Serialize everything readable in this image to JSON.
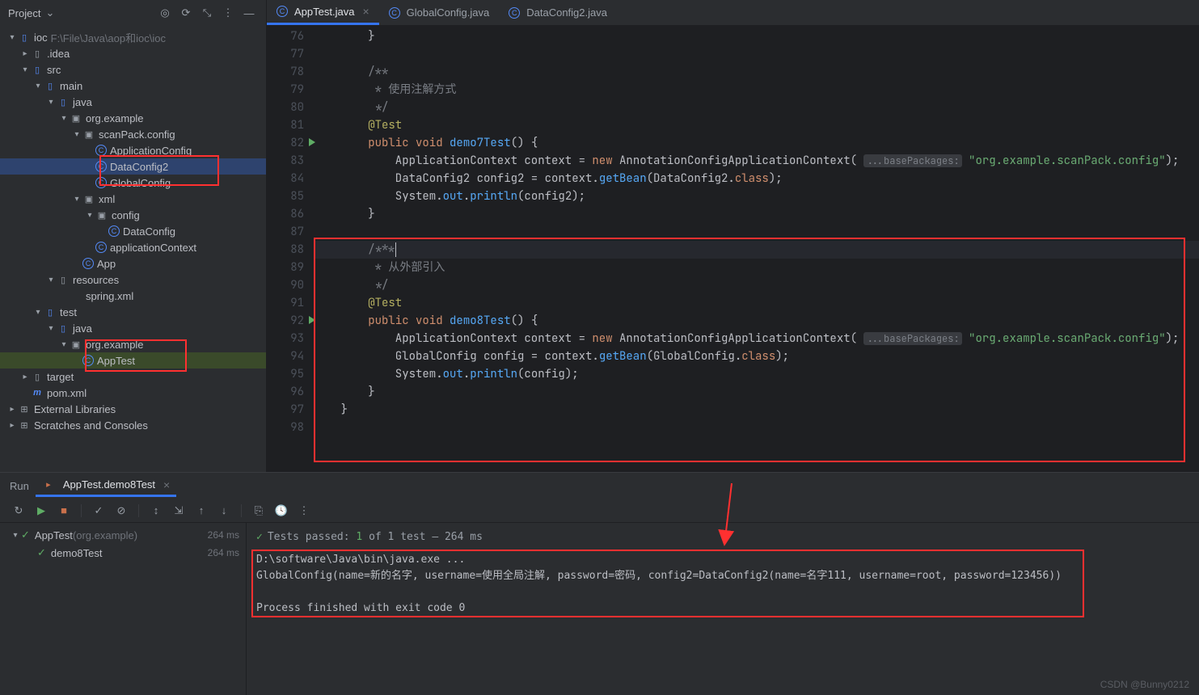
{
  "sidebar": {
    "title": "Project",
    "root": "ioc",
    "rootPath": "F:\\File\\Java\\aop和ioc\\ioc",
    "nodes": {
      "idea": ".idea",
      "src": "src",
      "main": "main",
      "java": "java",
      "pkg": "org.example",
      "scanpack": "scanPack.config",
      "appconfig": "ApplicationConfig",
      "dataconfig2": "DataConfig2",
      "globalconfig": "GlobalConfig",
      "xml": "xml",
      "config": "config",
      "dataconfig": "DataConfig",
      "appcontext": "applicationContext",
      "app": "App",
      "resources": "resources",
      "springxml": "spring.xml",
      "test": "test",
      "testjava": "java",
      "testpkg": "org.example",
      "apptest": "AppTest",
      "target": "target",
      "pom": "pom.xml",
      "extlib": "External Libraries",
      "scratches": "Scratches and Consoles"
    }
  },
  "tabs": [
    {
      "label": "AppTest.java",
      "active": true
    },
    {
      "label": "GlobalConfig.java",
      "active": false
    },
    {
      "label": "DataConfig2.java",
      "active": false
    }
  ],
  "code": {
    "startLine": 76,
    "lines": [
      {
        "n": 76,
        "html": "        }"
      },
      {
        "n": 77,
        "html": ""
      },
      {
        "n": 78,
        "html": "        <span class='cmt'>/**</span>"
      },
      {
        "n": 79,
        "html": "        <span class='cmt'> * 使用注解方式</span>"
      },
      {
        "n": 80,
        "html": "        <span class='cmt'> */</span>"
      },
      {
        "n": 81,
        "html": "        <span class='ann'>@Test</span>"
      },
      {
        "n": 82,
        "html": "        <span class='kw'>public void</span> <span class='fn'>demo7Test</span>() {",
        "run": true
      },
      {
        "n": 83,
        "html": "            ApplicationContext context = <span class='kw'>new</span> <span class='cls'>AnnotationConfigApplicationContext</span>( <span class='hint'>...basePackages:</span> <span class='str'>\"org.example.scanPack.config\"</span>);"
      },
      {
        "n": 84,
        "html": "            DataConfig2 config2 = context.<span class='fn'>getBean</span>(DataConfig2.<span class='kw'>class</span>);"
      },
      {
        "n": 85,
        "html": "            System.<span class='fn'>out</span>.<span class='fn'>println</span>(config2);"
      },
      {
        "n": 86,
        "html": "        }"
      },
      {
        "n": 87,
        "html": ""
      },
      {
        "n": 88,
        "html": "        <span class='cmt'>/***</span><span class='caret'></span>",
        "cur": true
      },
      {
        "n": 89,
        "html": "        <span class='cmt'> * 从外部引入</span>"
      },
      {
        "n": 90,
        "html": "        <span class='cmt'> */</span>"
      },
      {
        "n": 91,
        "html": "        <span class='ann'>@Test</span>"
      },
      {
        "n": 92,
        "html": "        <span class='kw'>public void</span> <span class='fn'>demo8Test</span>() {",
        "run": true
      },
      {
        "n": 93,
        "html": "            ApplicationContext context = <span class='kw'>new</span> <span class='cls'>AnnotationConfigApplicationContext</span>( <span class='hint'>...basePackages:</span> <span class='str'>\"org.example.scanPack.config\"</span>);"
      },
      {
        "n": 94,
        "html": "            GlobalConfig config = context.<span class='fn'>getBean</span>(GlobalConfig.<span class='kw'>class</span>);"
      },
      {
        "n": 95,
        "html": "            System.<span class='fn'>out</span>.<span class='fn'>println</span>(config);"
      },
      {
        "n": 96,
        "html": "        }"
      },
      {
        "n": 97,
        "html": "    }"
      },
      {
        "n": 98,
        "html": ""
      }
    ]
  },
  "run": {
    "label": "Run",
    "tab": "AppTest.demo8Test",
    "testsPrefix": "Tests passed:",
    "testsCount": "1",
    "testsSuffix": "of 1 test – 264 ms",
    "rows": [
      {
        "name": "AppTest",
        "pkg": "(org.example)",
        "time": "264 ms"
      },
      {
        "name": "demo8Test",
        "pkg": "",
        "time": "264 ms"
      }
    ],
    "console": [
      "D:\\software\\Java\\bin\\java.exe ...",
      "GlobalConfig(name=新的名字, username=使用全局注解, password=密码, config2=DataConfig2(name=名字111, username=root, password=123456))",
      "",
      "Process finished with exit code 0"
    ]
  },
  "watermark": "CSDN @Bunny0212"
}
